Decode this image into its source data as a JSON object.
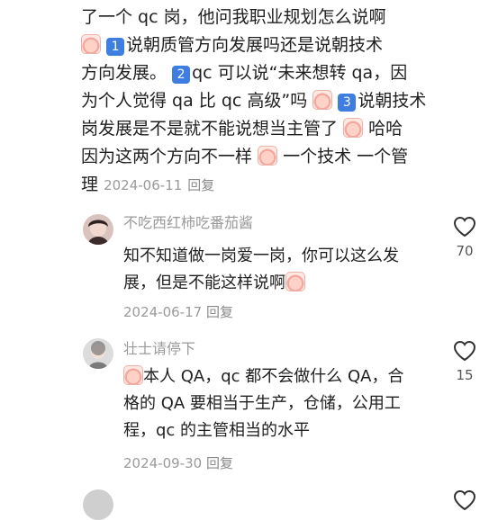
{
  "parent": {
    "lines": [
      "了一个 qc 岗，他问我职业规划怎么说啊",
      "说朝质管方向发展吗还是说朝技术",
      "方向发展。",
      "qc 可以说“未来想转 qa，因",
      "为个人觉得 qa 比 qc 高级”吗",
      "说朝技术",
      "岗发展是不是就不能说想当主管了",
      "哈哈",
      "因为这两个方向不一样",
      "一个技术 一个管",
      "理"
    ],
    "nums": [
      "1",
      "2",
      "3"
    ],
    "date": "2024-06-11",
    "reply": "回复"
  },
  "comments": [
    {
      "username": "不吃西红柿吃番茄酱",
      "lines": [
        "知不知道做一岗爱一岗，你可以这么发",
        "展，但是不能这样说啊"
      ],
      "date": "2024-06-17",
      "reply": "回复",
      "likes": "70"
    },
    {
      "username": "壮士请停下",
      "lines": [
        "本人 QA，qc 都不会做什么 QA，合",
        "格的 QA 要相当于生产，仓储，公用工",
        "程，qc 的主管相当的水平"
      ],
      "date": "2024-09-30",
      "reply": "回复",
      "likes": "15"
    }
  ],
  "colors": {
    "accent": "#3d7ee0",
    "muted": "#9a9a9a",
    "text": "#1f1f1f"
  },
  "icons": {
    "emoji": "crying-face-emoji-icon",
    "like": "heart-outline-icon"
  }
}
